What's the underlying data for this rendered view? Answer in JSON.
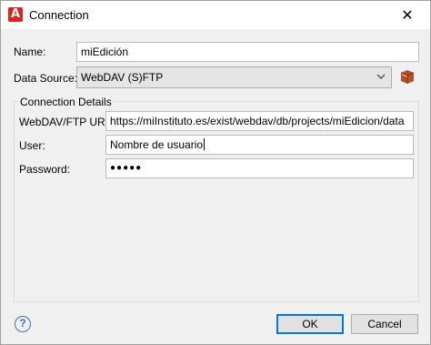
{
  "window": {
    "title": "Connection",
    "app_icon_letter": "A"
  },
  "form": {
    "name_label": "Name:",
    "name_value": "miEdición",
    "data_source_label": "Data Source:",
    "data_source_value": "WebDAV (S)FTP"
  },
  "connection_details": {
    "group_title": "Connection Details",
    "url_label": "WebDAV/FTP URL:",
    "url_value": "https://miInstituto.es/exist/webdav/db/projects/miEdicion/data",
    "user_label": "User:",
    "user_value": "Nombre de usuario",
    "password_label": "Password:",
    "password_value": "●●●●●"
  },
  "footer": {
    "help_glyph": "?",
    "ok_label": "OK",
    "cancel_label": "Cancel"
  },
  "colors": {
    "accent": "#0078d7",
    "app_icon": "#d9261c",
    "help_icon": "#3a6fc4"
  }
}
